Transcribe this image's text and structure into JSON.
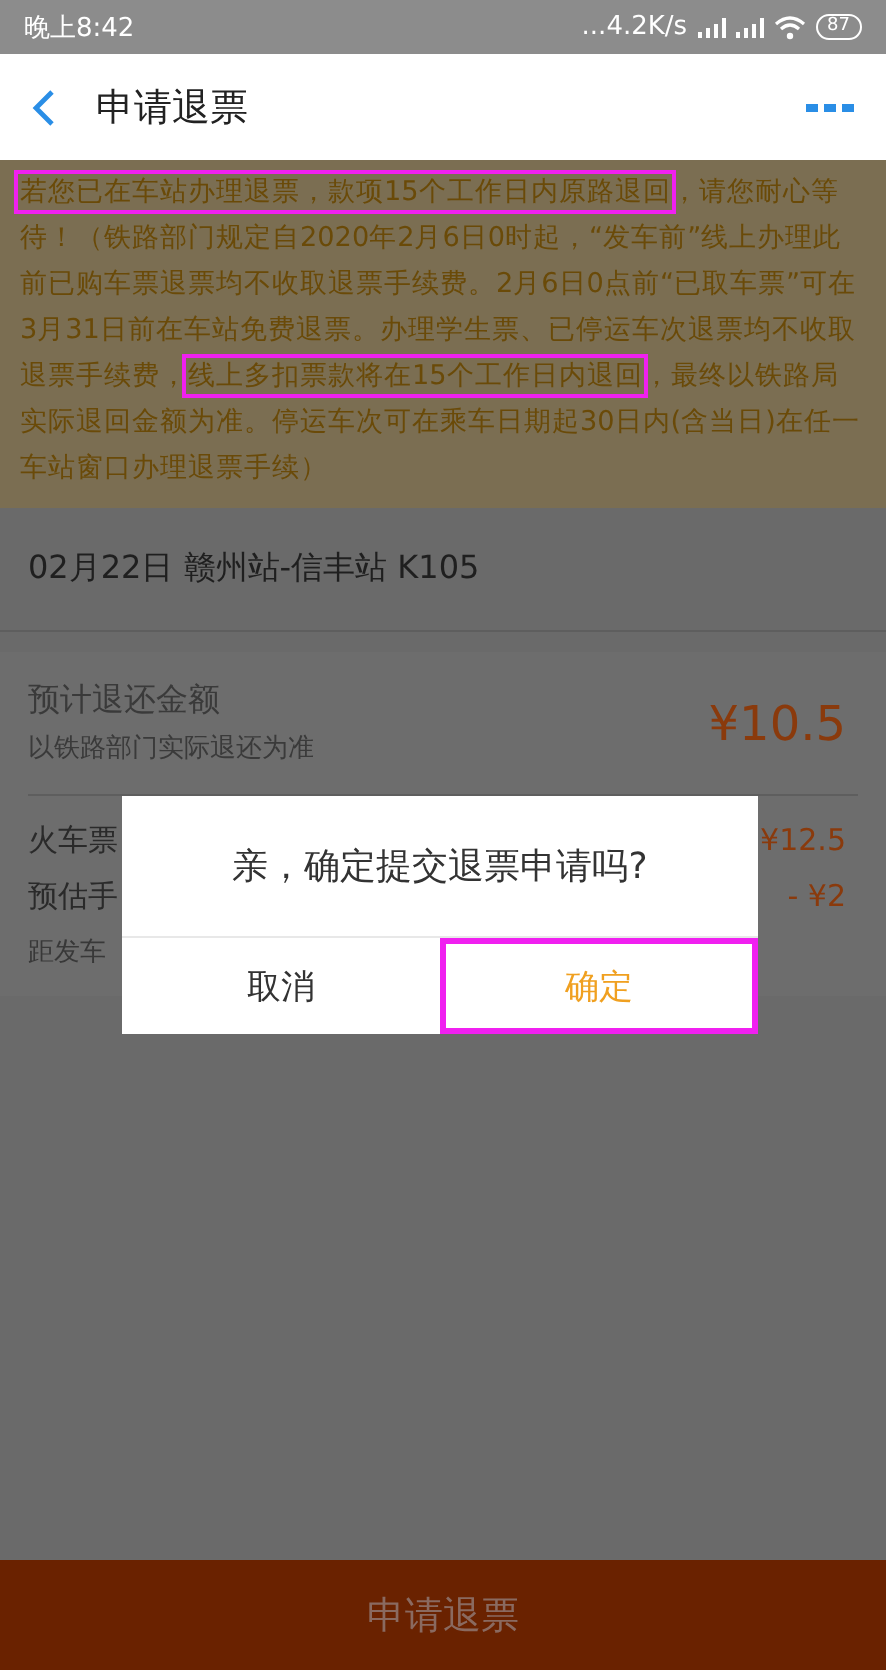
{
  "status_bar": {
    "time": "晚上8:42",
    "speed": "...4.2K/s",
    "battery": "87"
  },
  "header": {
    "title": "申请退票"
  },
  "notice": [
    {
      "text": "若您已在车站办理退票，款项15个工作日内原路退回",
      "highlighted": true
    },
    {
      "text": "，请您耐心等待！（铁路部门规定自2020年2月6日0时起，“发车前”线上办理此前已购车票退票均不收取退票手续费。2月6日0点前“已取车票”可在3月31日前在车站免费退票。办理学生票、已停运车次退票均不收取退票手续费，",
      "highlighted": false
    },
    {
      "text": "线上多扣票款将在15个工作日内退回",
      "highlighted": true
    },
    {
      "text": "，最终以铁路局实际退回金额为准。停运车次可在乘车日期起30日内(含当日)在任一车站窗口办理退票手续）",
      "highlighted": false
    }
  ],
  "trip": "02月22日 赣州站-信丰站 K105",
  "refund": {
    "label": "预计退还金额",
    "note": "以铁路部门实际退还为准",
    "amount": "¥10.5"
  },
  "fees": [
    {
      "label": "火车票",
      "value": "¥12.5"
    },
    {
      "label": "预估手",
      "value": "- ¥2"
    },
    {
      "label": "距发车"
    }
  ],
  "dialog": {
    "message": "亲，确定提交退票申请吗?",
    "buttons": [
      {
        "label": "取消",
        "kind": "cancel",
        "highlighted": false
      },
      {
        "label": "确定",
        "kind": "confirm",
        "highlighted": true
      }
    ]
  },
  "submit_button": "申请退票"
}
